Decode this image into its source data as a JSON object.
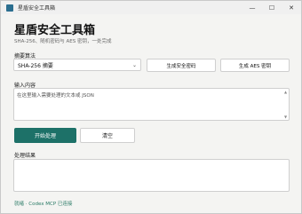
{
  "window": {
    "title": "星盾安全工具箱",
    "minimize": "—",
    "maximize": "☐",
    "close": "✕"
  },
  "header": {
    "title": "星盾安全工具箱",
    "subtitle": "SHA-256、随机密码与 AES 密钥，一处完成"
  },
  "algorithm": {
    "label": "摘要算法",
    "selected": "SHA-256 摘要",
    "chevron": "⌄"
  },
  "actions": {
    "generate_password": "生成安全密码",
    "generate_aes": "生成 AES 密钥"
  },
  "input": {
    "label": "输入内容",
    "placeholder": "在这里输入需要处理的文本或 JSON",
    "scroll_up": "▲",
    "scroll_down": "▼"
  },
  "buttons": {
    "process": "开始处理",
    "clear": "清空"
  },
  "output": {
    "label": "处理结果"
  },
  "status": {
    "text": "就绪 · Codex MCP 已连接"
  },
  "colors": {
    "accent": "#1d7168",
    "status": "#2a7a66"
  }
}
